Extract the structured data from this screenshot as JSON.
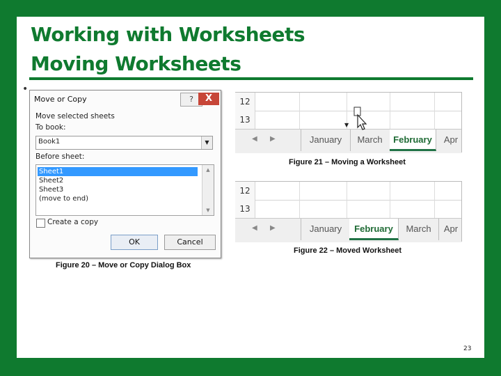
{
  "slide": {
    "title_line1": "Working with Worksheets",
    "title_line2": "Moving Worksheets",
    "bullet": "•",
    "page_number": "23"
  },
  "dialog": {
    "title": "Move or Copy",
    "help": "?",
    "close": "X",
    "move_label": "Move selected sheets",
    "to_book_label": "To book:",
    "to_book_value": "Book1",
    "before_sheet_label": "Before sheet:",
    "sheets": [
      "Sheet1",
      "Sheet2",
      "Sheet3",
      "(move to end)"
    ],
    "selected_sheet": "Sheet1",
    "create_copy_label": "Create a copy",
    "create_copy_checked": false,
    "ok_label": "OK",
    "cancel_label": "Cancel"
  },
  "captions": {
    "fig20": "Figure 20 – Move or Copy Dialog Box",
    "fig21": "Figure 21 – Moving a Worksheet",
    "fig22": "Figure 22 – Moved Worksheet"
  },
  "fig21": {
    "rows": [
      "12",
      "13"
    ],
    "tabs": [
      "January",
      "March",
      "February",
      "Apr"
    ],
    "active_tab": "February"
  },
  "fig22": {
    "rows": [
      "12",
      "13"
    ],
    "tabs": [
      "January",
      "February",
      "March",
      "Apr"
    ],
    "active_tab": "February"
  },
  "colors": {
    "brand_green": "#0f7a2f",
    "excel_green": "#217346",
    "selection_blue": "#3399ff",
    "close_red": "#c74638"
  }
}
